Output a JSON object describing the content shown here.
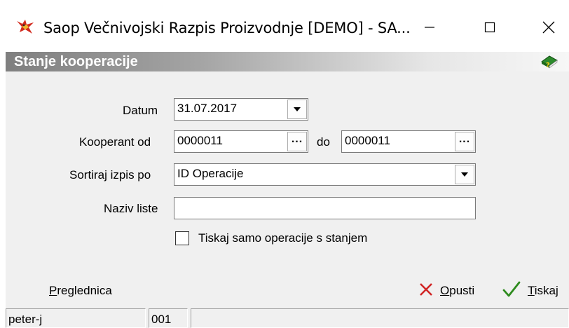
{
  "window": {
    "title": "Saop  Večnivojski Razpis Proizvodnje [DEMO] - SA...",
    "app_icon": "saop-bird-logo-icon",
    "controls": {
      "minimize": "minimize-icon",
      "maximize": "maximize-icon",
      "close": "close-icon"
    }
  },
  "header": {
    "title": "Stanje kooperacije",
    "help_icon": "help-book-icon"
  },
  "form": {
    "datum": {
      "label": "Datum",
      "value": "31.07.2017"
    },
    "kooperant": {
      "label": "Kooperant od",
      "from": "0000011",
      "to_label": "do",
      "to": "0000011"
    },
    "sort": {
      "label": "Sortiraj izpis po",
      "value": "ID Operacije"
    },
    "naziv": {
      "label": "Naziv liste",
      "value": ""
    },
    "checkbox": {
      "label": "Tiskaj samo operacije s stanjem",
      "checked": false
    }
  },
  "actions": {
    "preview": "Preglednica",
    "cancel": "Opusti",
    "print": "Tiskaj",
    "cancel_color": "#d12727",
    "print_color": "#2e8b1e"
  },
  "status": {
    "user": "peter-j",
    "code": "001",
    "extra": ""
  }
}
